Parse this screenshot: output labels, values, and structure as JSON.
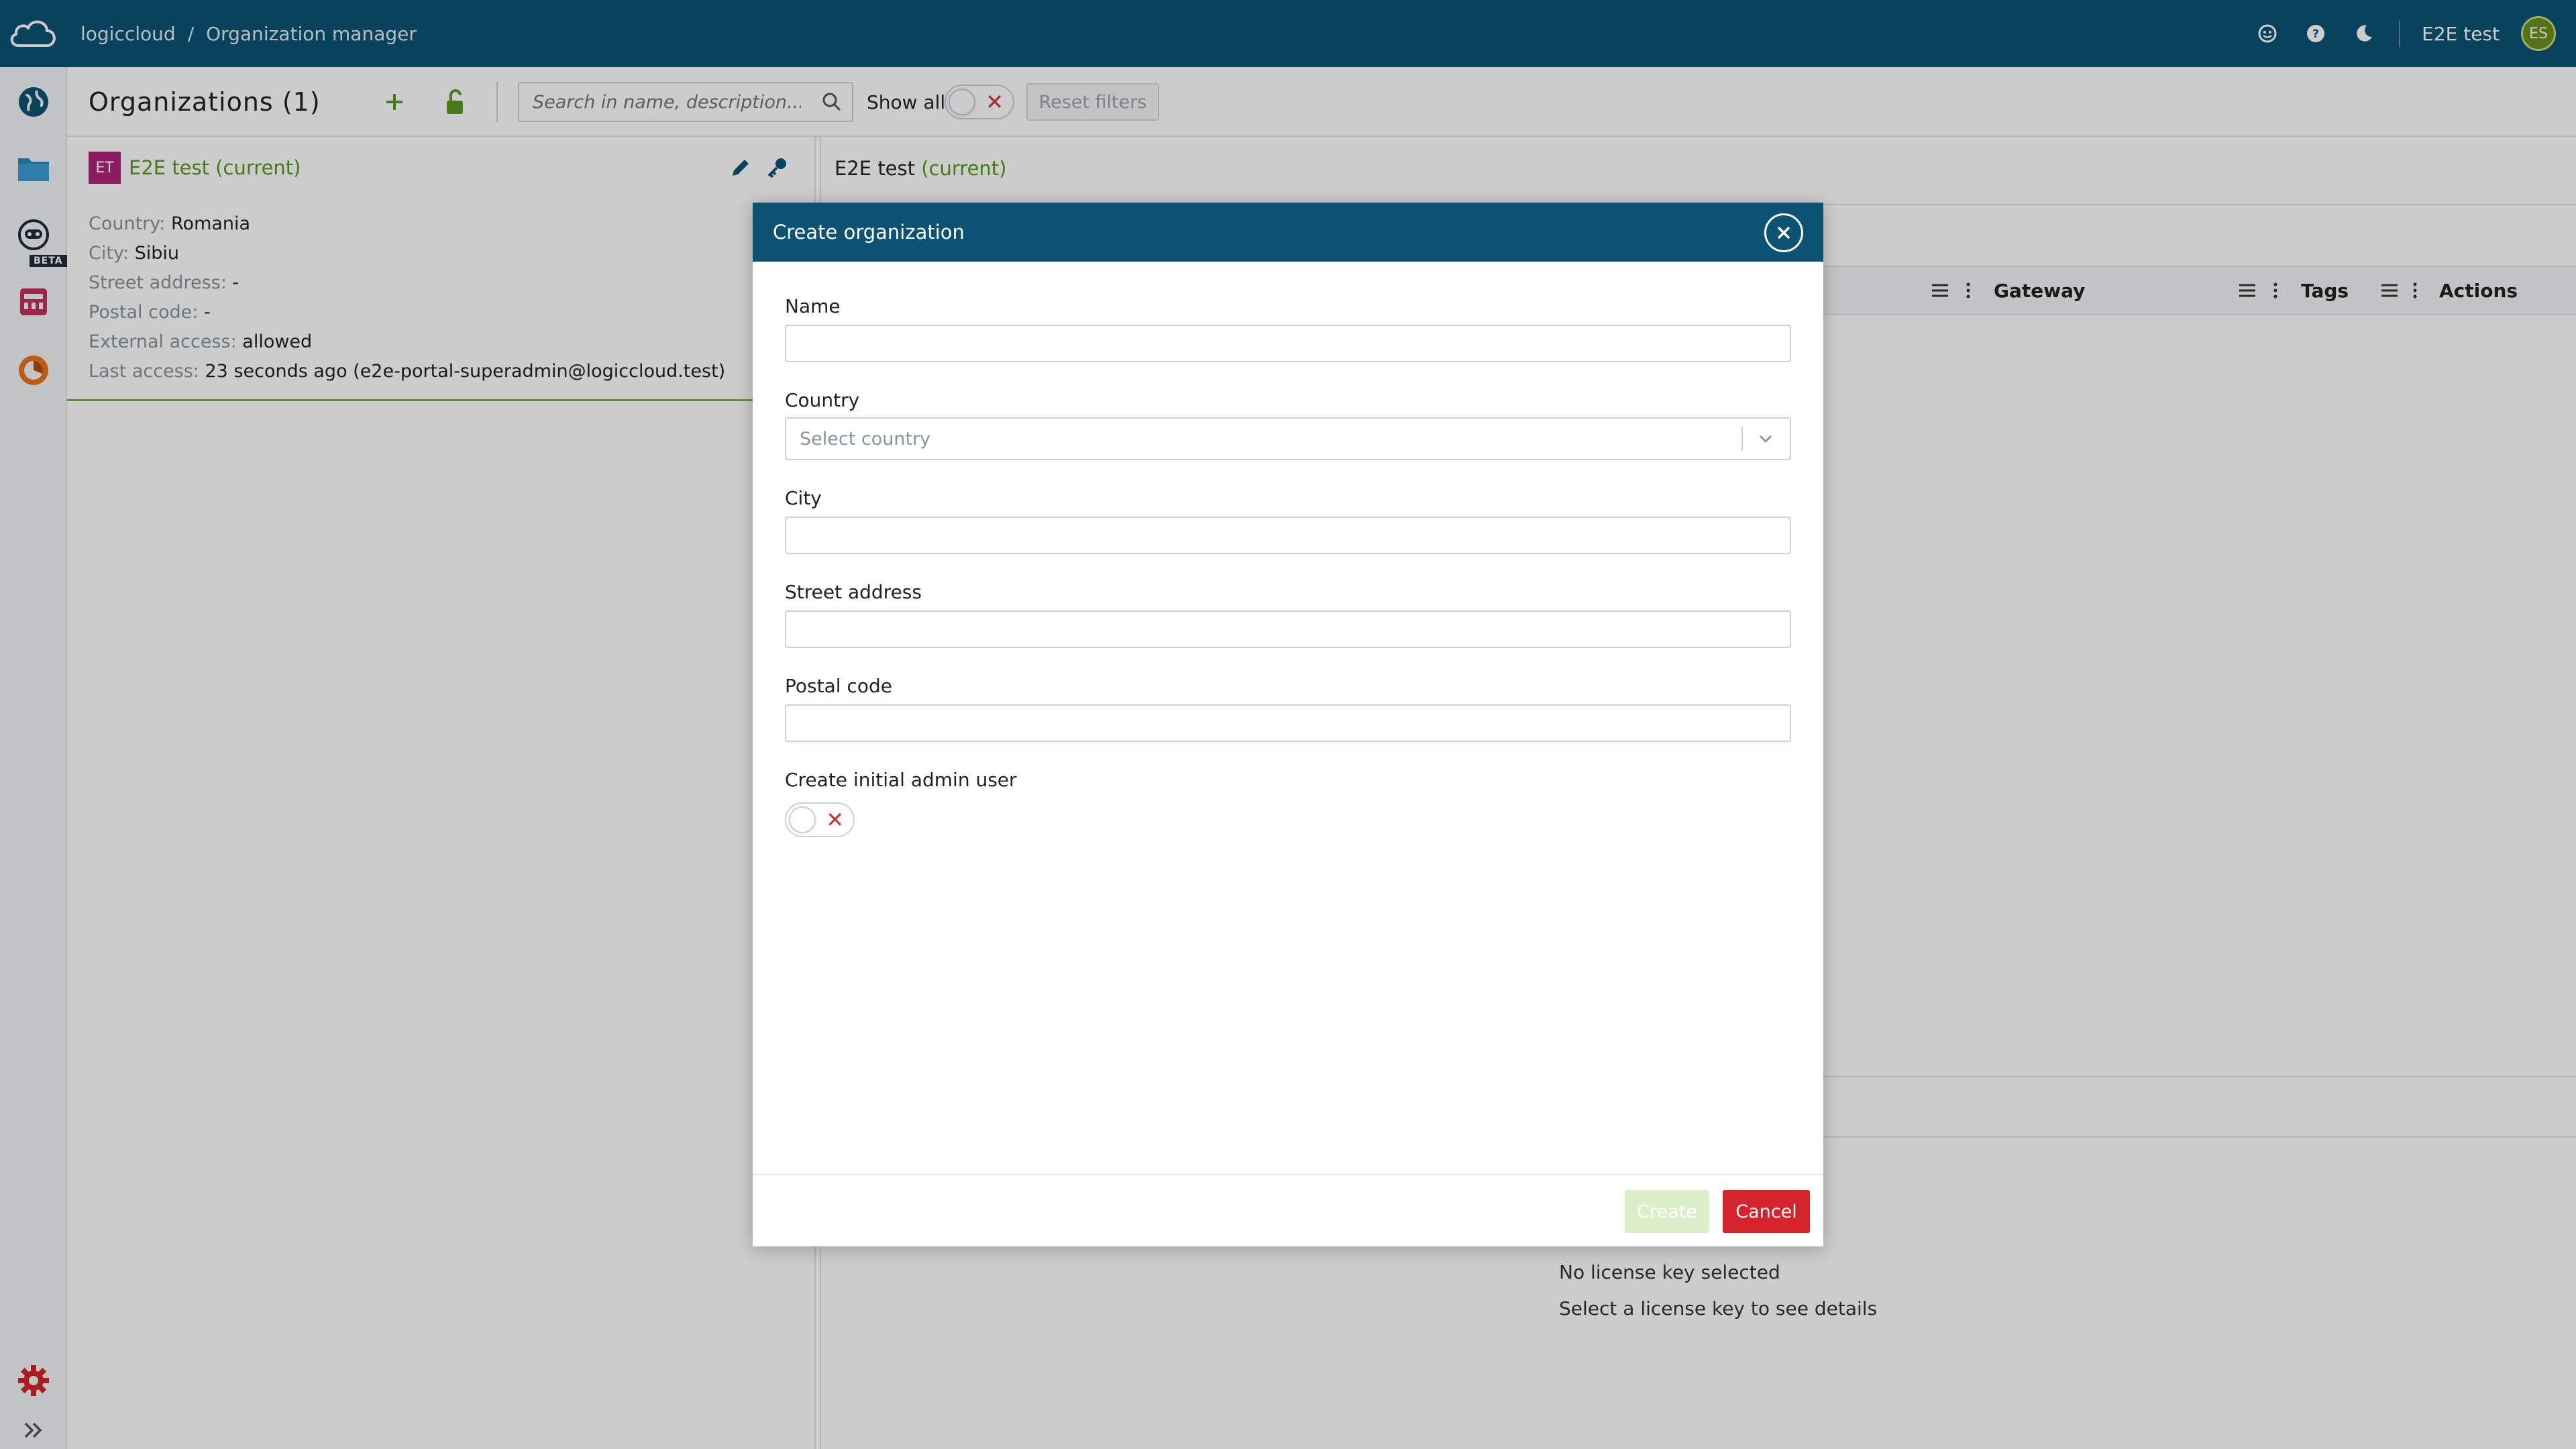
{
  "topbar": {
    "app_name": "logiccloud",
    "separator": "/",
    "page": "Organization manager",
    "user_name": "E2E test",
    "user_initials": "ES",
    "icons": [
      "cloud-logo-icon",
      "feedback-icon",
      "help-icon",
      "dark-mode-icon"
    ]
  },
  "rail": {
    "items": [
      "globe-icon",
      "folder-icon",
      "robot-icon",
      "device-icon",
      "analytics-icon"
    ],
    "beta_label": "BETA",
    "bottom": [
      "settings-icon",
      "expand-icon"
    ]
  },
  "toolbar": {
    "title": "Organizations (1)",
    "search_placeholder": "Search in name, description...",
    "show_all_label": "Show all",
    "show_all_on": false,
    "reset_label": "Reset filters"
  },
  "org": {
    "badge": "ET",
    "name": "E2E test",
    "current_tag": "(current)",
    "rows": [
      {
        "label": "Country:",
        "value": "Romania"
      },
      {
        "label": "City:",
        "value": "Sibiu"
      },
      {
        "label": "Street address:",
        "value": "-"
      },
      {
        "label": "Postal code:",
        "value": "-"
      },
      {
        "label": "External access:",
        "value": "allowed"
      },
      {
        "label": "Last access:",
        "value": "23 seconds ago (e2e-portal-superadmin@logiccloud.test)"
      }
    ]
  },
  "detail": {
    "title": "E2E test",
    "current_tag": "(current)",
    "columns": [
      "Gateway",
      "Tags",
      "Actions"
    ],
    "no_license": "No license key selected",
    "select_license": "Select a license key to see details"
  },
  "modal": {
    "title": "Create organization",
    "fields": {
      "name_label": "Name",
      "name_value": "",
      "country_label": "Country",
      "country_placeholder": "Select country",
      "city_label": "City",
      "city_value": "",
      "street_label": "Street address",
      "street_value": "",
      "postal_label": "Postal code",
      "postal_value": "",
      "admin_label": "Create initial admin user",
      "admin_on": false
    },
    "create_label": "Create",
    "cancel_label": "Cancel"
  },
  "colors": {
    "primary": "#0c5373",
    "accent_green": "#5a9a1f",
    "danger": "#d4242b",
    "org_badge": "#b0247a"
  }
}
